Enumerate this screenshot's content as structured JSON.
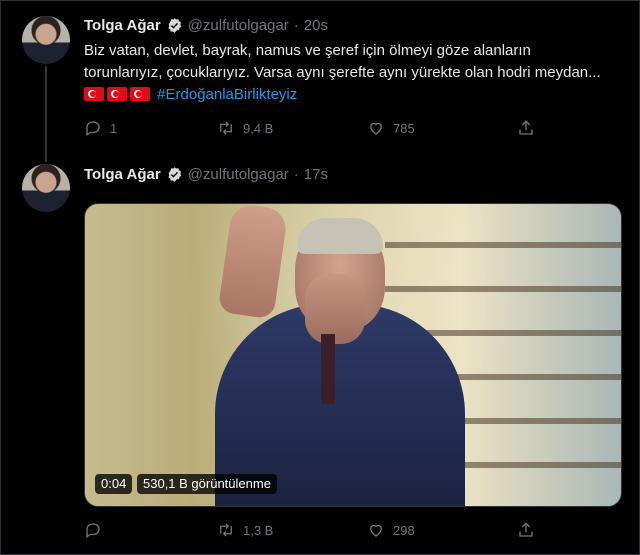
{
  "tweets": [
    {
      "author": {
        "name": "Tolga Ağar",
        "handle": "@zulfutolgagar",
        "avatar": "avatar"
      },
      "time": "20s",
      "text": "Biz vatan, devlet, bayrak, namus ve şeref için ölmeyi göze alanların torunlarıyız, çocuklarıyız. Varsa aynı şerefte aynı yürekte olan hodri meydan...",
      "hashtag": "#ErdoğanlaBirlikteyiz",
      "emoji": [
        "turkey-flag",
        "turkey-flag",
        "turkey-flag"
      ],
      "stats": {
        "reply": "1",
        "retweet": "9,4 B",
        "like": "785"
      }
    },
    {
      "author": {
        "name": "Tolga Ağar",
        "handle": "@zulfutolgagar",
        "avatar": "avatar"
      },
      "time": "17s",
      "media": {
        "type": "video",
        "duration": "0:04",
        "views": "530,1 B görüntülenme"
      },
      "stats": {
        "reply": "",
        "retweet": "1,3 B",
        "like": "298"
      }
    }
  ],
  "colors": {
    "background": "#000000",
    "text": "#e7e9ea",
    "muted": "#71767b",
    "link": "#1d9bf0",
    "verified": "#d9d9d9"
  }
}
